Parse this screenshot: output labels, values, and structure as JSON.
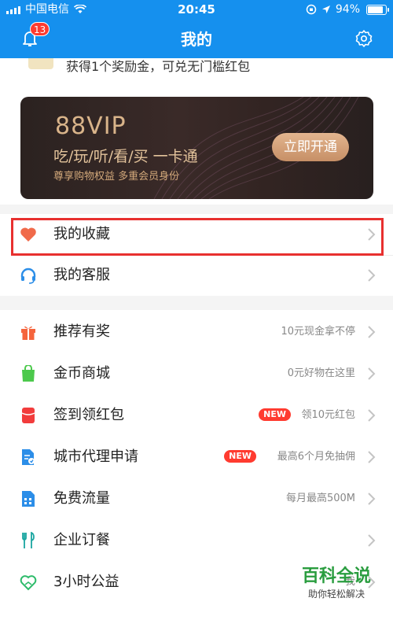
{
  "status": {
    "carrier": "中国电信",
    "time": "20:45",
    "battery": "94%",
    "battery_fraction": 0.94
  },
  "header": {
    "title": "我的",
    "notification_count": "13"
  },
  "promo": {
    "text": "获得1个奖励金，可兑无门槛红包"
  },
  "vip": {
    "title": "88VIP",
    "subtitle": "吃/玩/听/看/买 一卡通",
    "description": "尊享购物权益 多重会员身份",
    "button": "立即开通"
  },
  "group1": [
    {
      "label": "我的收藏",
      "icon": "heart-icon"
    },
    {
      "label": "我的客服",
      "icon": "headset-icon"
    }
  ],
  "group2": [
    {
      "label": "推荐有奖",
      "hint": "10元现金拿不停",
      "icon": "gift-icon"
    },
    {
      "label": "金币商城",
      "hint": "0元好物在这里",
      "icon": "shopping-bag-icon"
    },
    {
      "label": "签到领红包",
      "hint": "领10元红包",
      "new": "NEW",
      "icon": "red-envelope-icon"
    },
    {
      "label": "城市代理申请",
      "hint": "最高6个月免抽佣",
      "new": "NEW",
      "icon": "document-icon"
    },
    {
      "label": "免费流量",
      "hint": "每月最高500M",
      "icon": "sim-card-icon"
    },
    {
      "label": "企业订餐",
      "hint": "",
      "icon": "fork-knife-icon"
    },
    {
      "label": "3小时公益",
      "hint": "我",
      "icon": "charity-icon"
    }
  ],
  "watermark": {
    "main": "百科全说",
    "sub": "助你轻松解决"
  },
  "colors": {
    "header": "#1590ee",
    "highlight": "#e8302f",
    "new_badge": "#ff3b30"
  }
}
